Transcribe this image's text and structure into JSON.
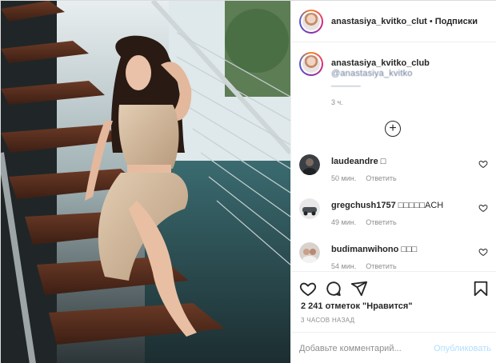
{
  "header": {
    "username": "anastasiya_kvitko_clut",
    "separator": "•",
    "follow_label": "Подписки"
  },
  "caption": {
    "username": "anastasiya_kvitko_club",
    "line1": "@anastasiya_kvitko",
    "line2": "______",
    "time": "3 ч."
  },
  "load_more_icon": "plus-circle-icon",
  "comments": [
    {
      "username": "laudeandre",
      "text": "□",
      "time": "50 мин.",
      "reply": "Ответить"
    },
    {
      "username": "gregchush1757",
      "text": "□□□□□ACH",
      "time": "49 мин.",
      "reply": "Ответить"
    },
    {
      "username": "budimanwihono",
      "text": "□□□",
      "time": "54 мин.",
      "reply": "Ответить"
    }
  ],
  "actions": {
    "icons": [
      "heart-icon",
      "comment-icon",
      "share-icon",
      "bookmark-icon"
    ]
  },
  "likes_text": "2 241 отметок \"Нравится\"",
  "time_ago": "3 ЧАСОВ НАЗАД",
  "add_comment": {
    "placeholder": "Добавьте комментарий...",
    "post_label": "Опубликовать"
  },
  "colors": {
    "text": "#262626",
    "muted": "#8e8e8e",
    "link_disabled": "#b2dffc",
    "border": "#efefef"
  }
}
